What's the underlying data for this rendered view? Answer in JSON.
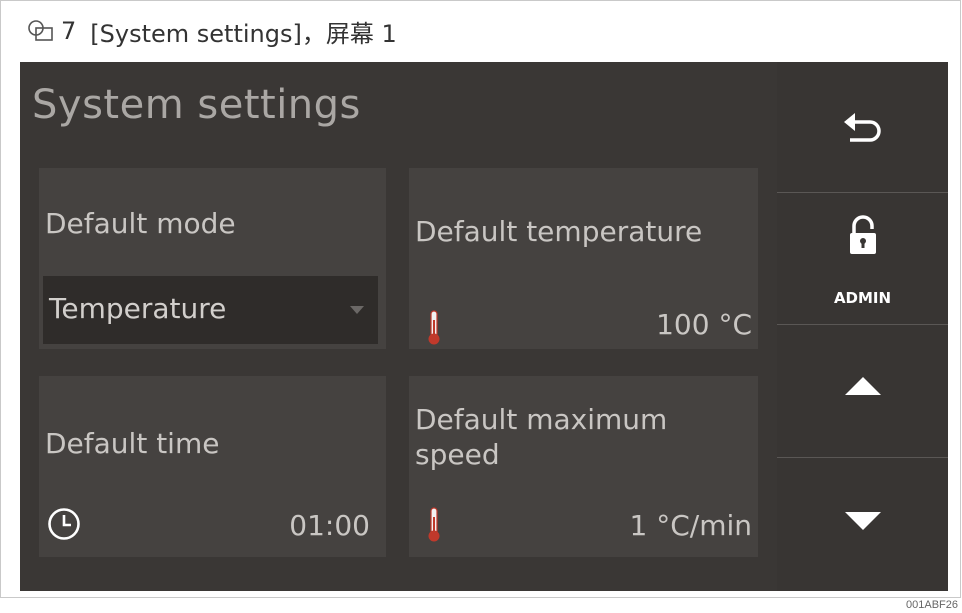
{
  "caption": {
    "figure_number": "7",
    "text": "[System settings]，屏幕 1"
  },
  "screen": {
    "title": "System settings",
    "tiles": {
      "default_mode": {
        "label": "Default mode",
        "dropdown_value": "Temperature"
      },
      "default_temperature": {
        "label": "Default temperature",
        "value": "100 °C",
        "icon": "thermometer-icon"
      },
      "default_time": {
        "label": "Default time",
        "value": "01:00",
        "icon": "clock-icon"
      },
      "default_max_speed": {
        "label": "Default maximum speed",
        "value": "1 °C/min",
        "icon": "thermometer-icon"
      }
    },
    "sidebar": {
      "back": {
        "icon": "back-arrow-icon"
      },
      "admin": {
        "icon": "unlocked-padlock-icon",
        "label": "ADMIN"
      },
      "up": {
        "icon": "triangle-up-icon"
      },
      "down": {
        "icon": "triangle-down-icon"
      }
    }
  },
  "image_code": "001ABF26",
  "colors": {
    "screen_bg": "#3a3735",
    "tile_bg": "#454240",
    "sidebar_bg": "#383533",
    "thermometer_red": "#c0392b",
    "text": "#c9c6c3"
  }
}
